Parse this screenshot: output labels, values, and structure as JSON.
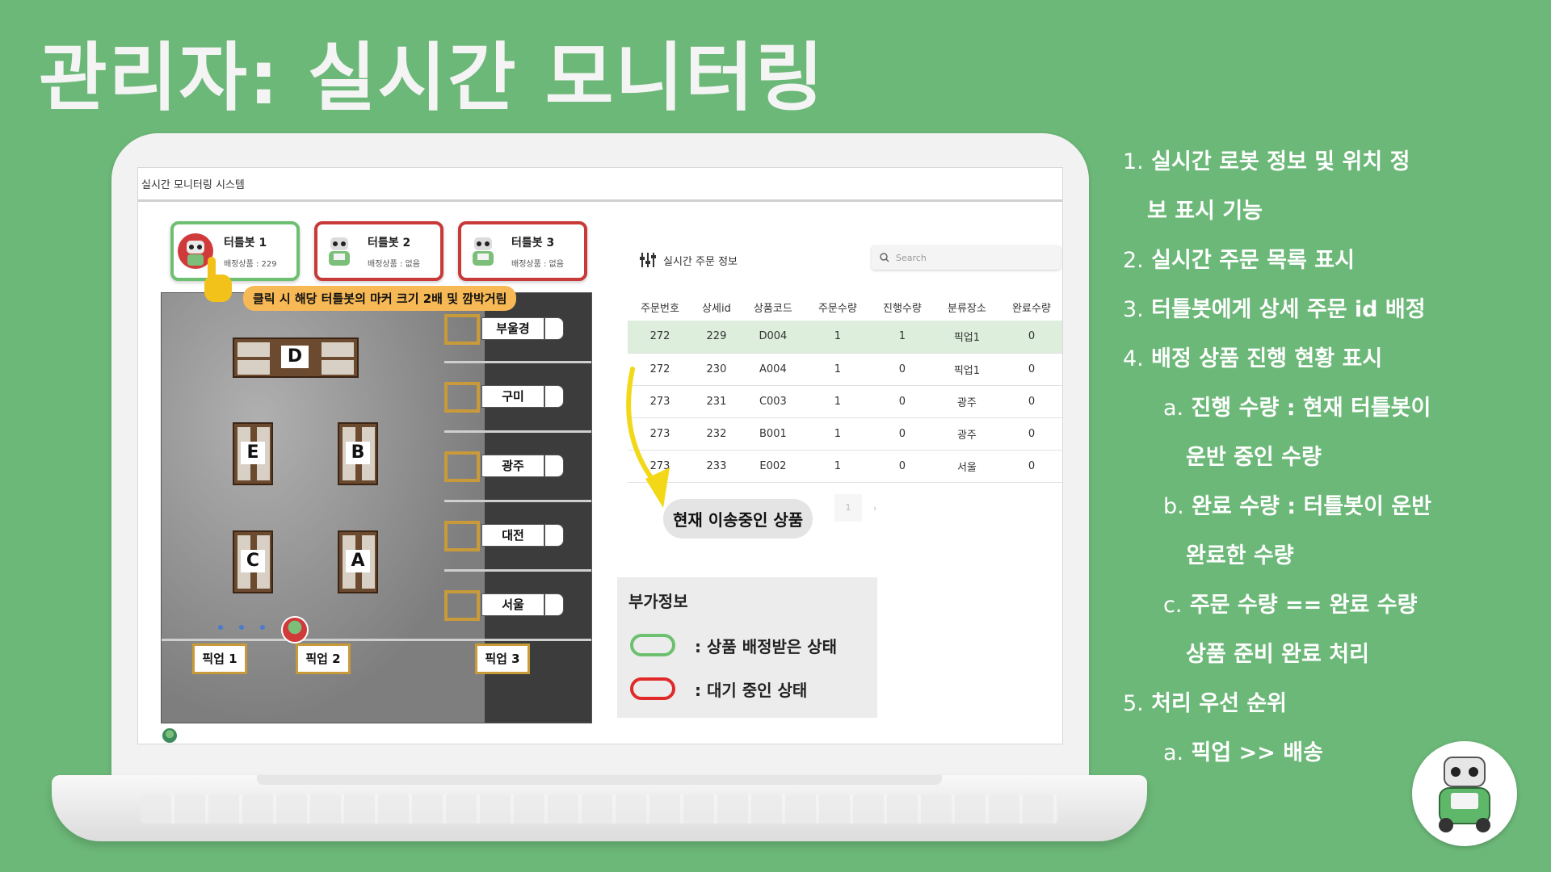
{
  "slide": {
    "title": "관리자: 실시간 모니터링"
  },
  "app": {
    "title": "실시간 모니터링 시스템"
  },
  "robots": [
    {
      "name": "터틀봇 1",
      "info": "배정상품 : 229",
      "status": "assigned"
    },
    {
      "name": "터틀봇 2",
      "info": "배정상품 : 없음",
      "status": "idle"
    },
    {
      "name": "터틀봇 3",
      "info": "배정상품 : 없음",
      "status": "idle"
    }
  ],
  "callouts": {
    "click_hint": "클릭 시 해당 터틀봇의 마커 크기 2배 및 깜박거림",
    "in_transit": "현재 이송중인 상품"
  },
  "map": {
    "shelves": [
      "D",
      "E",
      "B",
      "C",
      "A"
    ],
    "docks": [
      "부울경",
      "구미",
      "광주",
      "대전",
      "서울"
    ],
    "pickups": [
      "픽업 1",
      "픽업 2",
      "픽업 3"
    ]
  },
  "orders": {
    "title": "실시간 주문 정보",
    "search_placeholder": "Search",
    "columns": [
      "주문번호",
      "상세id",
      "상품코드",
      "주문수량",
      "진행수량",
      "분류장소",
      "완료수량"
    ],
    "rows": [
      [
        "272",
        "229",
        "D004",
        "1",
        "1",
        "픽업1",
        "0"
      ],
      [
        "272",
        "230",
        "A004",
        "1",
        "0",
        "픽업1",
        "0"
      ],
      [
        "273",
        "231",
        "C003",
        "1",
        "0",
        "광주",
        "0"
      ],
      [
        "273",
        "232",
        "B001",
        "1",
        "0",
        "광주",
        "0"
      ],
      [
        "273",
        "233",
        "E002",
        "1",
        "0",
        "서울",
        "0"
      ]
    ],
    "pager": {
      "page": "1",
      "next": "›"
    }
  },
  "info_panel": {
    "title": "부가정보",
    "assigned_label": ": 상품 배정받은 상태",
    "idle_label": ": 대기 중인 상태"
  },
  "features": [
    {
      "num": "1.",
      "text": "실시간 로봇 정보 및 위치 정"
    },
    {
      "num": "",
      "text": "보 표시 기능"
    },
    {
      "num": "2.",
      "text": "실시간 주문 목록 표시"
    },
    {
      "num": "3.",
      "text": "터틀봇에게 상세 주문 id 배정"
    },
    {
      "num": "4.",
      "text": "배정 상품 진행 현황 표시"
    },
    {
      "num": "a.",
      "text": "진행 수량 : 현재 터틀봇이"
    },
    {
      "num": "",
      "text": "운반 중인 수량"
    },
    {
      "num": "b.",
      "text": "완료 수량 : 터틀봇이 운반"
    },
    {
      "num": "",
      "text": "완료한 수량"
    },
    {
      "num": "c.",
      "text": "주문 수량 == 완료 수량"
    },
    {
      "num": "",
      "text": "상품 준비 완료 처리"
    },
    {
      "num": "5.",
      "text": "처리 우선 순위"
    },
    {
      "num": "a.",
      "text": "픽업 >> 배송"
    }
  ],
  "colors": {
    "background": "#6cb878",
    "assigned": "#6cc070",
    "idle": "#c83a3a",
    "highlight_row": "#ddeedd",
    "callout": "#f7b955",
    "arrow": "#f2d817"
  },
  "icons": [
    "hand-pointer-icon",
    "sliders-icon",
    "search-icon",
    "robot-icon",
    "arrow-icon"
  ]
}
